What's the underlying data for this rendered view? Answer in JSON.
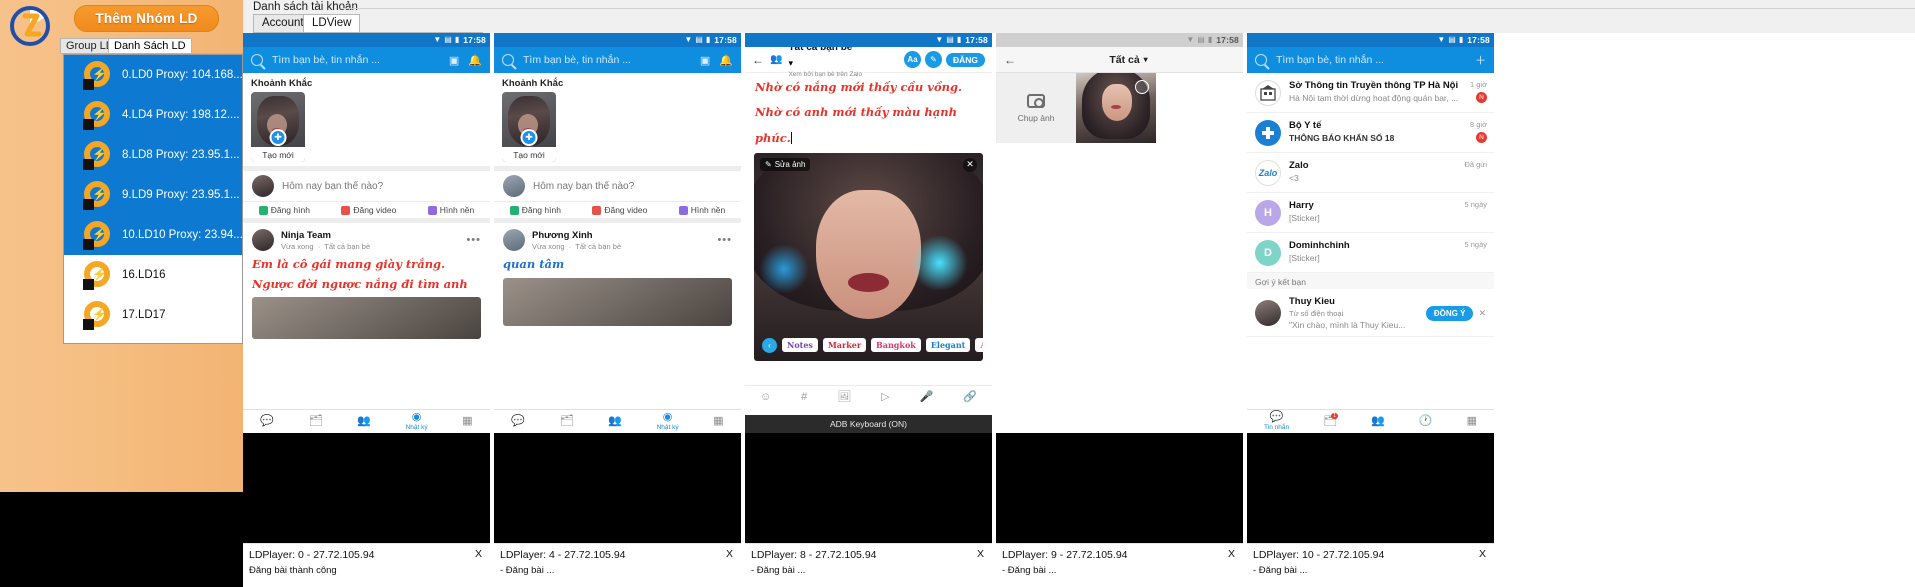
{
  "sidebar": {
    "add_group_button": "Thêm Nhóm LD",
    "tabs": [
      {
        "label": "Group LD",
        "active": false
      },
      {
        "label": "Danh Sách LD",
        "active": true
      }
    ],
    "items": [
      {
        "label": "0.LD0 Proxy: 104.168...",
        "selected": true
      },
      {
        "label": "4.LD4 Proxy: 198.12....",
        "selected": true
      },
      {
        "label": "8.LD8 Proxy: 23.95.1...",
        "selected": true
      },
      {
        "label": "9.LD9 Proxy: 23.95.1...",
        "selected": true
      },
      {
        "label": "10.LD10 Proxy: 23.94...",
        "selected": true
      },
      {
        "label": "16.LD16",
        "selected": false
      },
      {
        "label": "17.LD17",
        "selected": false
      }
    ]
  },
  "account_bar": {
    "title": "Danh sách tài khoản",
    "tabs": [
      {
        "label": "Account",
        "active": false
      },
      {
        "label": "LDView",
        "active": true
      }
    ]
  },
  "status_time": "17:58",
  "panels": [
    {
      "id": "p0",
      "search_placeholder": "Tìm bạn bè, tin nhắn ...",
      "section_title": "Khoảnh Khắc",
      "moment_caption": "Tạo mới",
      "status_prompt": "Hôm nay bạn thế nào?",
      "actions": [
        "Đăng hình",
        "Đăng video",
        "Hình nền"
      ],
      "post_author": "Ninja Team",
      "post_time": "Vừa xong",
      "post_audience": "Tất cả bạn bè",
      "post_line1": "Em là cô gái mang giày trắng.",
      "post_line2": "Ngược đời ngược nắng đi tìm anh",
      "tabbar": [
        "",
        "",
        "",
        "Nhật ký",
        ""
      ],
      "footer_title": "LDPlayer: 0 - 27.72.105.94",
      "footer_close": "X",
      "footer_status": "Đăng bài thành công"
    },
    {
      "id": "p1",
      "search_placeholder": "Tìm bạn bè, tin nhắn ...",
      "section_title": "Khoảnh Khắc",
      "moment_caption": "Tạo mới",
      "status_prompt": "Hôm nay bạn thế nào?",
      "actions": [
        "Đăng hình",
        "Đăng video",
        "Hình nền"
      ],
      "post_author": "Phương Xinh",
      "post_time": "Vừa xong",
      "post_audience": "Tất cả bạn bè",
      "post_line1": "quan tâm",
      "post_line2": "",
      "tabbar": [
        "",
        "",
        "",
        "Nhật ký",
        ""
      ],
      "footer_title": "LDPlayer: 4 - 27.72.105.94",
      "footer_close": "X",
      "footer_status": "- Đăng bài ..."
    },
    {
      "id": "p2",
      "editor_title": "Tất cả bạn bè",
      "editor_subtitle": "Xem bởi bạn bè trên Zalo",
      "btn_aa": "Aa",
      "btn_pen": "✎",
      "btn_post": "ĐĂNG",
      "text_line1": "Nhờ có nắng mới thấy cầu vồng.",
      "text_line2": "Nhờ có anh mới thấy màu hạnh",
      "text_line3": "phúc.",
      "edit_photo_chip": "Sửa ảnh",
      "stickers": [
        "Notes",
        "Marker",
        "Bangkok",
        "Elegant",
        "Athens"
      ],
      "adb_bar": "ADB Keyboard (ON)",
      "footer_title": "LDPlayer: 8 - 27.72.105.94",
      "footer_close": "X",
      "footer_status": "- Đăng bài ..."
    },
    {
      "id": "p3",
      "picker_title": "Tất cả",
      "camera_label": "Chụp ảnh",
      "footer_title": "LDPlayer: 9 - 27.72.105.94",
      "footer_close": "X",
      "footer_status": "- Đăng bài ..."
    },
    {
      "id": "p4",
      "search_placeholder": "Tìm bạn bè, tin nhắn ...",
      "chats": [
        {
          "name": "Sở Thông tin Truyền thông TP Hà Nội",
          "msg": "Hà Nội tạm thời dừng hoạt động quán bar, ...",
          "time": "1 giờ",
          "badge": "N",
          "av_color": "#ffffff",
          "av_text": "",
          "av_kind": "building"
        },
        {
          "name": "Bộ Y tế",
          "msg": "THÔNG BÁO KHẨN SỐ 18",
          "time": "8 giờ",
          "badge": "N",
          "av_color": "#1b7fd4",
          "av_text": "",
          "av_kind": "health"
        },
        {
          "name": "Zalo",
          "msg": "<3",
          "time": "Đã gửi",
          "badge": "",
          "av_color": "#ffffff",
          "av_text": "",
          "av_kind": "zalo"
        },
        {
          "name": "Harry",
          "msg": "[Sticker]",
          "time": "5 ngày",
          "badge": "",
          "av_color": "#b8a8e8",
          "av_text": "H",
          "av_kind": "letter"
        },
        {
          "name": "Dominhchinh",
          "msg": "[Sticker]",
          "time": "5 ngày",
          "badge": "",
          "av_color": "#7fd4c8",
          "av_text": "D",
          "av_kind": "letter"
        }
      ],
      "suggest_header": "Gợi ý kết bạn",
      "suggest": {
        "name": "Thuy Kieu",
        "source": "Từ số điện thoại",
        "msg": "\"Xin chào, mình là Thuy Kieu...",
        "button": "ĐỒNG Ý",
        "close": "✕"
      },
      "tabbar": [
        "Tin nhắn",
        "",
        "",
        "",
        ""
      ],
      "tabbar_badge": "1",
      "footer_title": "LDPlayer: 10 - 27.72.105.94",
      "footer_close": "X",
      "footer_status": "- Đăng bài ..."
    }
  ],
  "colors": {
    "sidebar_orange": "#f5bd80",
    "button_orange": "#f29020",
    "selection_blue": "#0d79d0",
    "zalo_blue": "#0f8ee0",
    "post_red": "#e8332a",
    "post_blue": "#1f6fd0"
  }
}
